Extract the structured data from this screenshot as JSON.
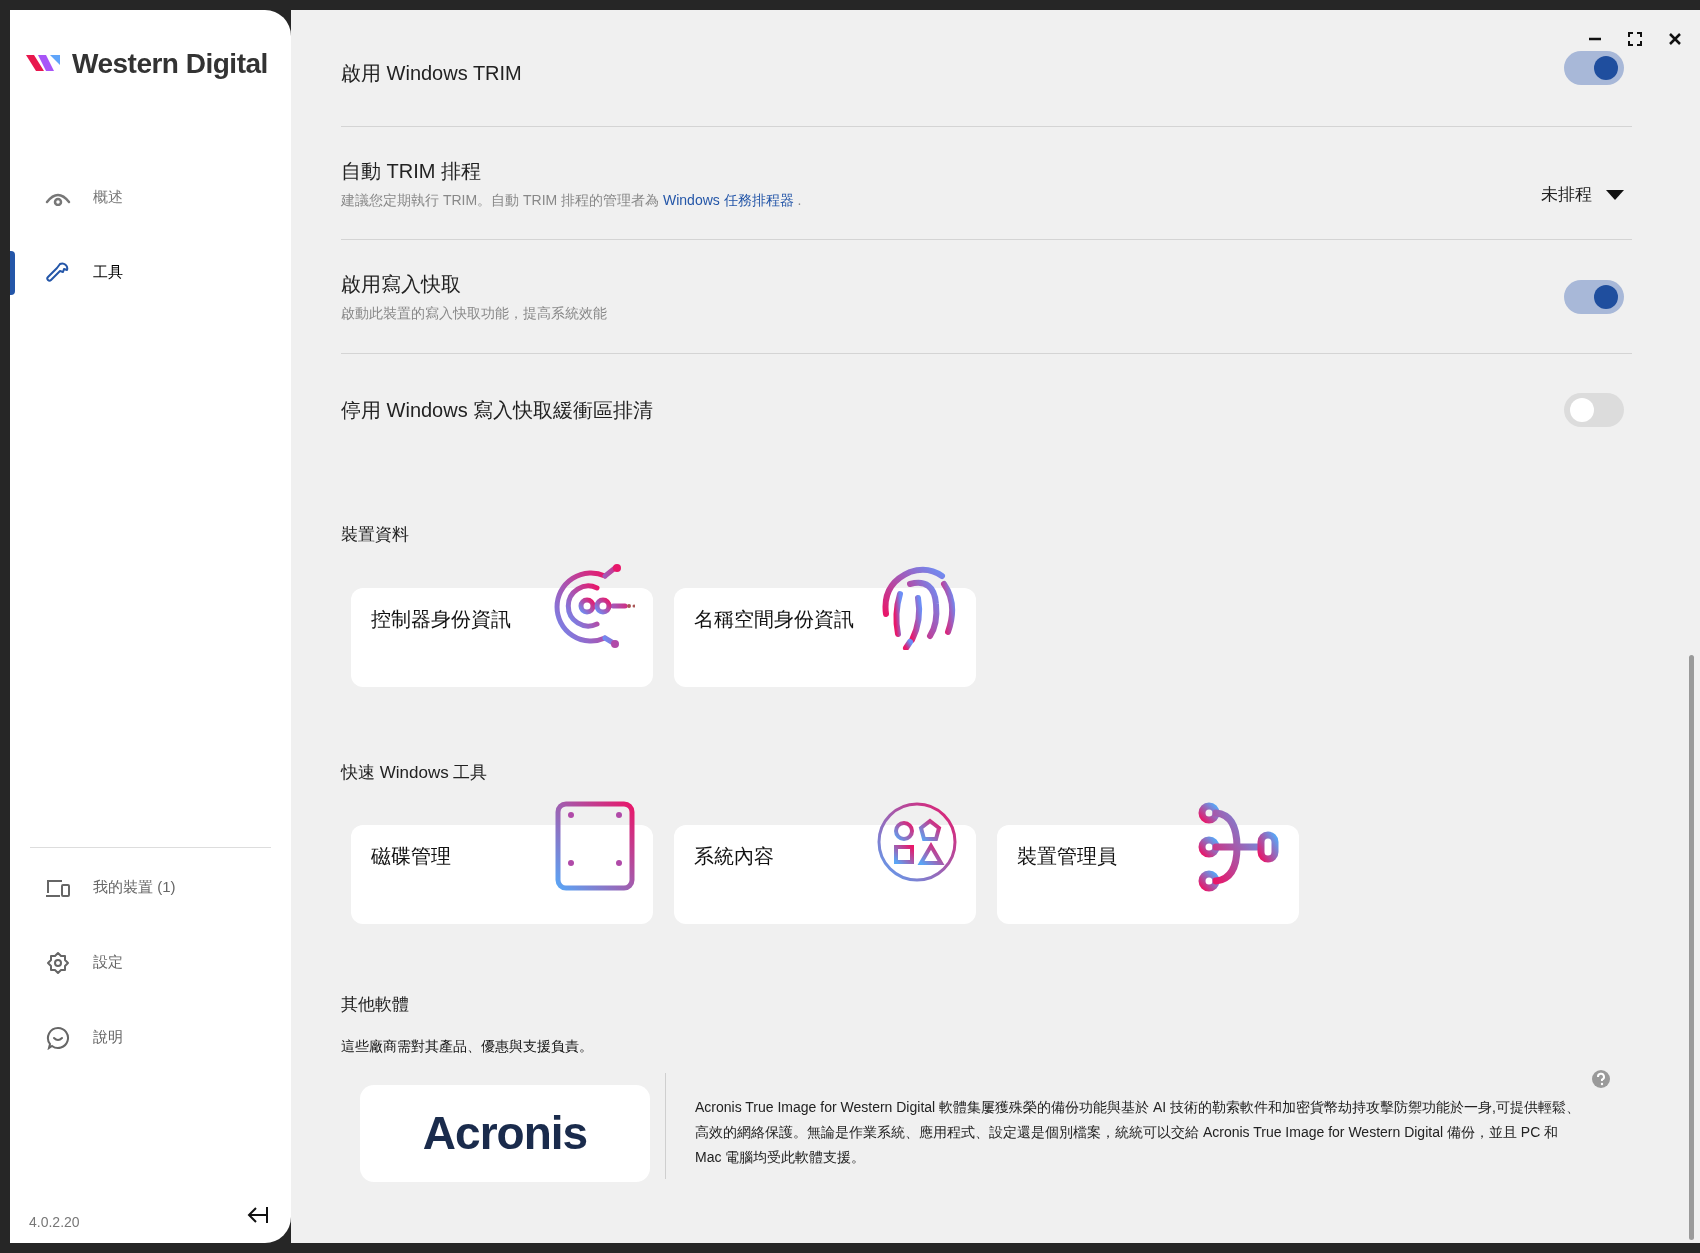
{
  "sidebar": {
    "logo": "Western Digital",
    "nav": [
      {
        "label": "概述",
        "kind": "overview",
        "selected": false
      },
      {
        "label": "工具",
        "kind": "tools",
        "selected": true
      }
    ],
    "bottom_nav": [
      {
        "label": "我的裝置 (1)",
        "kind": "devices"
      },
      {
        "label": "設定",
        "kind": "settings"
      },
      {
        "label": "說明",
        "kind": "help"
      }
    ],
    "version": "4.0.2.20"
  },
  "settings": [
    {
      "title": "啟用 Windows TRIM",
      "kind": "toggle",
      "on": true
    },
    {
      "title": "自動 TRIM 排程",
      "kind": "dropdown",
      "subtitle": {
        "before": "建議您定期執行 TRIM。自動 TRIM 排程的管理者為 ",
        "link": "Windows 任務排程器",
        "after": " ."
      },
      "value": "未排程"
    },
    {
      "title": "啟用寫入快取",
      "kind": "toggle",
      "subtitle": {
        "before": "啟動此裝置的寫入快取功能，提高系統效能"
      },
      "on": true
    },
    {
      "title": "停用 Windows 寫入快取緩衝區排清",
      "kind": "toggle",
      "on": false
    }
  ],
  "device_info": {
    "heading": "裝置資料",
    "cards": [
      {
        "label": "控制器身份資訊",
        "kind": "controller"
      },
      {
        "label": "名稱空間身份資訊",
        "kind": "fingerprint"
      }
    ]
  },
  "windows_tools": {
    "heading": "快速 Windows 工具",
    "cards": [
      {
        "label": "磁碟管理",
        "kind": "disk"
      },
      {
        "label": "系統內容",
        "kind": "shapes"
      },
      {
        "label": "裝置管理員",
        "kind": "tree"
      }
    ]
  },
  "other_software": {
    "heading": "其他軟體",
    "note": "這些廠商需對其產品、優惠與支援負責。",
    "logo": "Acronis",
    "description": "Acronis True Image for Western Digital 軟體集屢獲殊榮的備份功能與基於 AI 技術的勒索軟件和加密貨幣劫持攻擊防禦功能於一身,可提供輕鬆、高效的網絡保護。無論是作業系統、應用程式、設定還是個別檔案，統統可以交給 Acronis True Image for Western Digital 備份，並且 PC 和 Mac 電腦均受此軟體支援。"
  }
}
